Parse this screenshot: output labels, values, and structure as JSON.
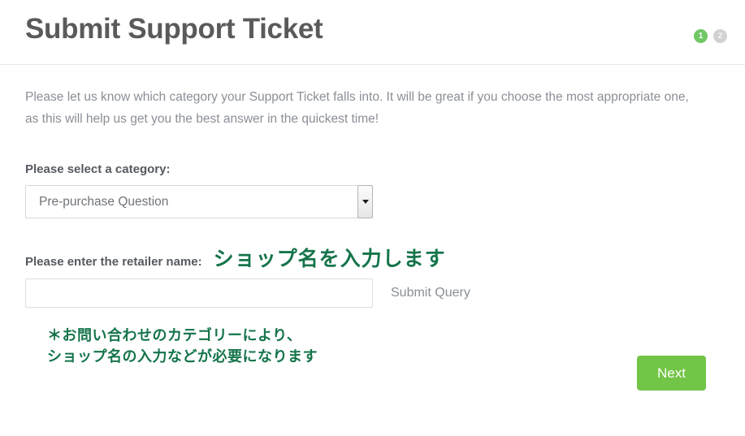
{
  "header": {
    "title": "Submit Support Ticket",
    "steps": [
      {
        "label": "1",
        "state": "active"
      },
      {
        "label": "2",
        "state": "inactive"
      }
    ]
  },
  "main": {
    "intro": "Please let us know which category your Support Ticket falls into. It will be great if you choose the most appropriate one, as this will help us get you the best answer in the quickest time!",
    "category": {
      "label": "Please select a category:",
      "selected": "Pre-purchase Question",
      "caret_icon": "chevron-down-icon"
    },
    "retailer": {
      "label": "Please enter the retailer name:",
      "annotation": "ショップ名を入力します",
      "value": "",
      "placeholder": "",
      "submit_query_label": "Submit Query"
    },
    "note_line_1": "＊お問い合わせのカテゴリーにより、",
    "note_line_2": "ショップ名の入力などが必要になります",
    "next_label": "Next"
  },
  "colors": {
    "accent_green": "#72c546",
    "step_active": "#70c764",
    "step_inactive": "#d2d2d2",
    "annotation_green": "#15744a",
    "title_gray": "#5a5a5a",
    "body_gray": "#8a8f96"
  }
}
